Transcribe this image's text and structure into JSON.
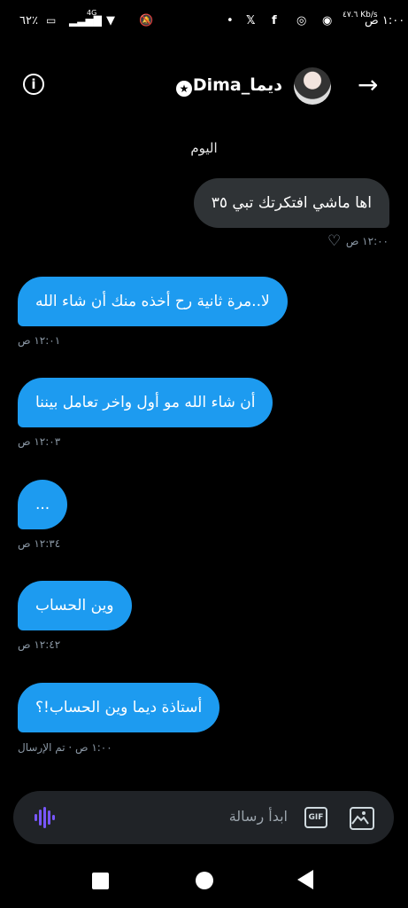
{
  "status_bar": {
    "battery": "٦٢٪",
    "signal": "4G",
    "time": "١:٠٠ ص",
    "speed": "٤٧.٦ Kb/s"
  },
  "header": {
    "name": "ديما_Dima",
    "badge": "★"
  },
  "day_label": "اليوم",
  "messages": [
    {
      "text": "اها ماشي افتكرتك تبي ٣٥",
      "time": "١٢:٠٠ ص"
    },
    {
      "text": "لا..مرة ثانية رح أخذه منك أن شاء الله",
      "time": "١٢:٠١ ص"
    },
    {
      "text": "أن شاء الله مو أول واخر تعامل بيننا",
      "time": "١٢:٠٣ ص"
    },
    {
      "text": "...",
      "time": "١٢:٣٤ ص"
    },
    {
      "text": "وين الحساب",
      "time": "١٢:٤٢ ص"
    },
    {
      "text": "أستاذة ديما وين الحساب!؟",
      "time": "١:٠٠ ص · تم الإرسال"
    }
  ],
  "composer": {
    "placeholder": "ابدأ رسالة",
    "gif": "GIF"
  },
  "icons": [
    "info-icon",
    "back-arrow-icon",
    "verified-star-icon",
    "heart-plus-icon",
    "voice-icon",
    "gif-icon",
    "image-icon"
  ]
}
